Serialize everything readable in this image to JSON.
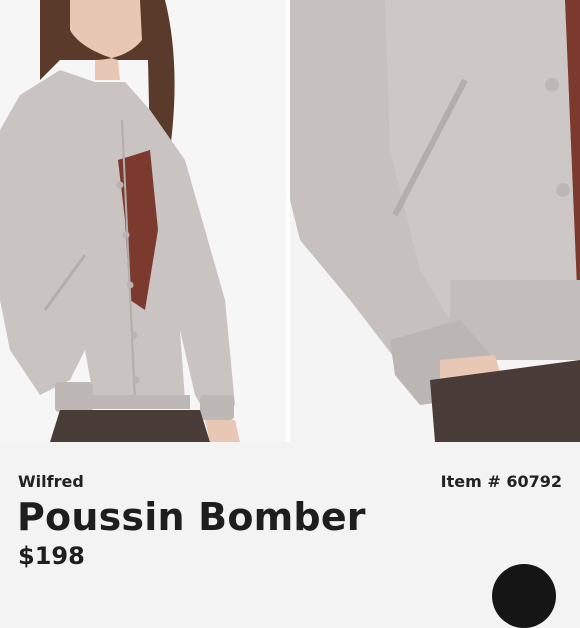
{
  "product": {
    "brand": "Wilfred",
    "item_number": "Item # 60792",
    "name": "Poussin Bomber",
    "price": "$198"
  },
  "images": [
    {
      "name": "model-front-photo"
    },
    {
      "name": "jacket-pocket-detail-photo"
    }
  ],
  "colors": {
    "jacket": "#c9c4c2",
    "inner_top": "#7c3a2e",
    "pants": "#4a3c38",
    "background": "#f3f3f3",
    "text": "#1e1e1e"
  }
}
